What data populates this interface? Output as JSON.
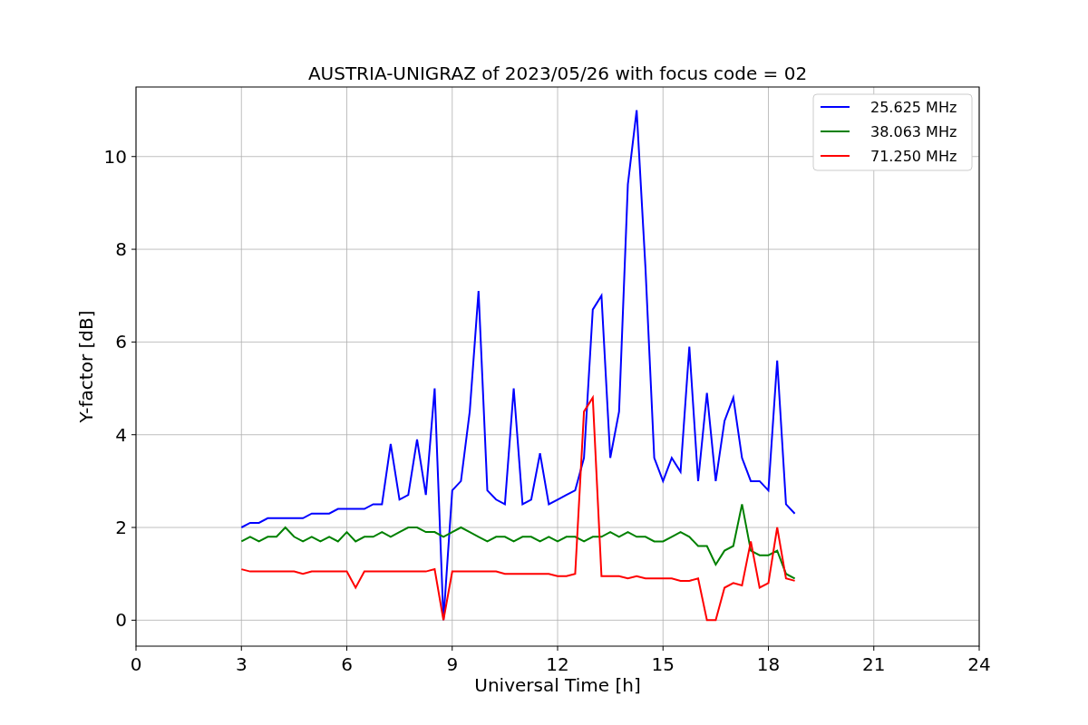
{
  "figure": {
    "chart_data": {
      "type": "line",
      "title": "AUSTRIA-UNIGRAZ of 2023/05/26 with focus code = 02",
      "xlabel": "Universal Time [h]",
      "ylabel": "Y-factor [dB]",
      "x": [
        3,
        3.25,
        3.5,
        3.75,
        4,
        4.25,
        4.5,
        4.75,
        5,
        5.25,
        5.5,
        5.75,
        6,
        6.25,
        6.5,
        6.75,
        7,
        7.25,
        7.5,
        7.75,
        8,
        8.25,
        8.5,
        8.75,
        9,
        9.25,
        9.5,
        9.75,
        10,
        10.25,
        10.5,
        10.75,
        11,
        11.25,
        11.5,
        11.75,
        12,
        12.25,
        12.5,
        12.75,
        13,
        13.25,
        13.5,
        13.75,
        14,
        14.25,
        14.5,
        14.75,
        15,
        15.25,
        15.5,
        15.75,
        16,
        16.25,
        16.5,
        16.75,
        17,
        17.25,
        17.5,
        17.75,
        18,
        18.25,
        18.5,
        18.75
      ],
      "series": [
        {
          "name": "25.625 MHz",
          "color": "#0000ff",
          "values": [
            2.0,
            2.1,
            2.1,
            2.2,
            2.2,
            2.2,
            2.2,
            2.2,
            2.3,
            2.3,
            2.3,
            2.4,
            2.4,
            2.4,
            2.4,
            2.5,
            2.5,
            3.8,
            2.6,
            2.7,
            3.9,
            2.7,
            5.0,
            0.0,
            2.8,
            3.0,
            4.5,
            7.1,
            2.8,
            2.6,
            2.5,
            5.0,
            2.5,
            2.6,
            3.6,
            2.5,
            2.6,
            2.7,
            2.8,
            3.5,
            6.7,
            7.0,
            3.5,
            4.5,
            9.4,
            11.0,
            7.6,
            3.5,
            3.0,
            3.5,
            3.2,
            5.9,
            3.0,
            4.9,
            3.0,
            4.3,
            4.8,
            3.5,
            3.0,
            3.0,
            2.8,
            5.6,
            2.5,
            2.3
          ]
        },
        {
          "name": "38.063 MHz",
          "color": "#008000",
          "values": [
            1.7,
            1.8,
            1.7,
            1.8,
            1.8,
            2.0,
            1.8,
            1.7,
            1.8,
            1.7,
            1.8,
            1.7,
            1.9,
            1.7,
            1.8,
            1.8,
            1.9,
            1.8,
            1.9,
            2.0,
            2.0,
            1.9,
            1.9,
            1.8,
            1.9,
            2.0,
            1.9,
            1.8,
            1.7,
            1.8,
            1.8,
            1.7,
            1.8,
            1.8,
            1.7,
            1.8,
            1.7,
            1.8,
            1.8,
            1.7,
            1.8,
            1.8,
            1.9,
            1.8,
            1.9,
            1.8,
            1.8,
            1.7,
            1.7,
            1.8,
            1.9,
            1.8,
            1.6,
            1.6,
            1.2,
            1.5,
            1.6,
            2.5,
            1.5,
            1.4,
            1.4,
            1.5,
            1.0,
            0.9
          ]
        },
        {
          "name": "71.250 MHz",
          "color": "#ff0000",
          "values": [
            1.1,
            1.05,
            1.05,
            1.05,
            1.05,
            1.05,
            1.05,
            1.0,
            1.05,
            1.05,
            1.05,
            1.05,
            1.05,
            0.7,
            1.05,
            1.05,
            1.05,
            1.05,
            1.05,
            1.05,
            1.05,
            1.05,
            1.1,
            0.0,
            1.05,
            1.05,
            1.05,
            1.05,
            1.05,
            1.05,
            1.0,
            1.0,
            1.0,
            1.0,
            1.0,
            1.0,
            0.95,
            0.95,
            1.0,
            4.5,
            4.8,
            0.95,
            0.95,
            0.95,
            0.9,
            0.95,
            0.9,
            0.9,
            0.9,
            0.9,
            0.85,
            0.85,
            0.9,
            0.0,
            0.0,
            0.7,
            0.8,
            0.75,
            1.7,
            0.7,
            0.8,
            2.0,
            0.9,
            0.85
          ]
        }
      ],
      "grid": true,
      "legend": true,
      "xlim": [
        0,
        24
      ],
      "ylim": [
        -0.56,
        11.5
      ],
      "xticks": [
        0,
        3,
        6,
        9,
        12,
        15,
        18,
        21,
        24
      ],
      "yticks": [
        0,
        2,
        4,
        6,
        8,
        10
      ]
    }
  }
}
